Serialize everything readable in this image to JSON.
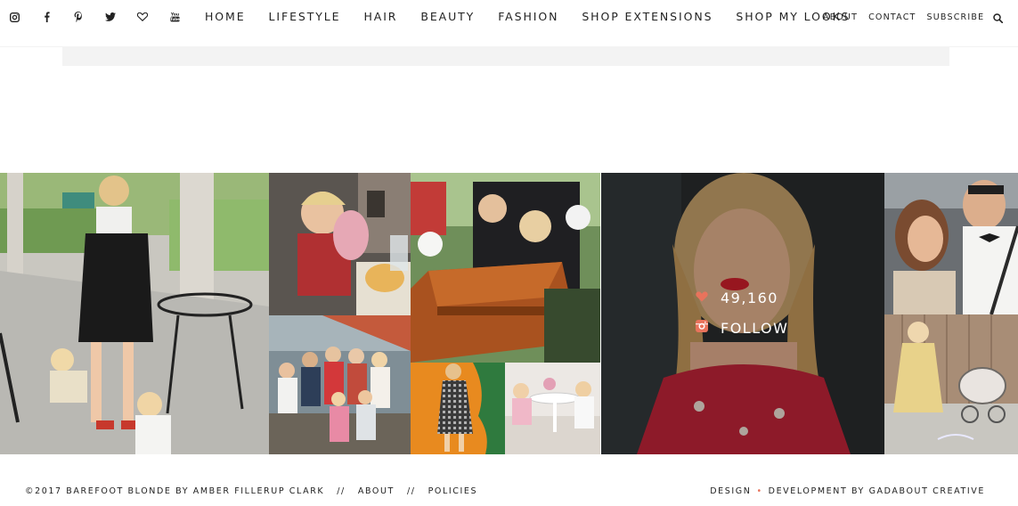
{
  "nav": {
    "social": [
      "instagram-icon",
      "facebook-icon",
      "pinterest-icon",
      "twitter-icon",
      "heart-icon",
      "youtube-icon"
    ],
    "menu": [
      "HOME",
      "LIFESTYLE",
      "HAIR",
      "BEAUTY",
      "FASHION",
      "SHOP EXTENSIONS",
      "SHOP MY LOOKS"
    ],
    "secondary": [
      "ABOUT",
      "CONTACT",
      "SUBSCRIBE"
    ]
  },
  "instagram": {
    "likes": "49,160",
    "follow": "FOLLOW",
    "accent": "#e8735c"
  },
  "footer": {
    "copyright": "©2017 BAREFOOT BLONDE BY AMBER FILLERUP CLARK",
    "sep1": "//",
    "about": "ABOUT",
    "sep2": "//",
    "policies": "POLICIES",
    "credit_design": "DESIGN",
    "credit_dot": "•",
    "credit_rest": "DEVELOPMENT BY GADABOUT CREATIVE"
  }
}
